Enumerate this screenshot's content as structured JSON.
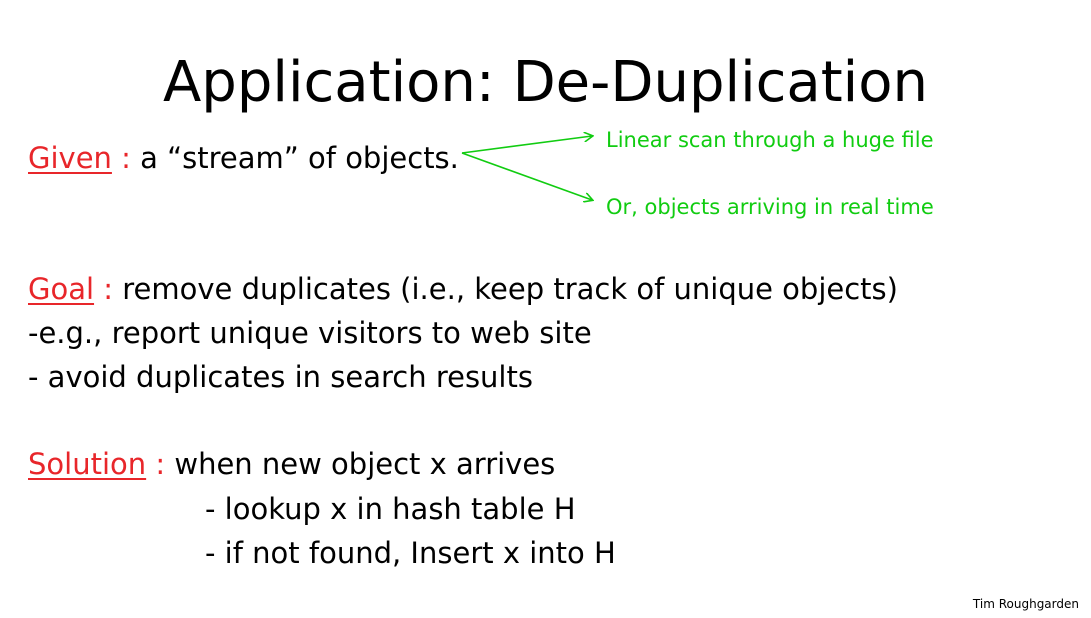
{
  "title": "Application: De-Duplication",
  "given": {
    "label": "Given",
    "colon": " :",
    "text": " a “stream” of objects."
  },
  "annotations": {
    "note1": "Linear scan through a huge file",
    "note2": "Or, objects arriving in real time",
    "color": "#11cc11"
  },
  "goal": {
    "label": "Goal",
    "colon": " :",
    "text": " remove duplicates (i.e., keep track of unique objects)",
    "items": [
      "-e.g., report unique visitors to web site",
      "- avoid duplicates in search results"
    ]
  },
  "solution": {
    "label": "Solution",
    "colon": " :",
    "text": " when new object x arrives",
    "steps": [
      "-  lookup x in hash table H",
      "-  if not found, Insert x into H"
    ]
  },
  "footer": "Tim Roughgarden",
  "colors": {
    "label": "#e8262a",
    "text": "#000000"
  }
}
